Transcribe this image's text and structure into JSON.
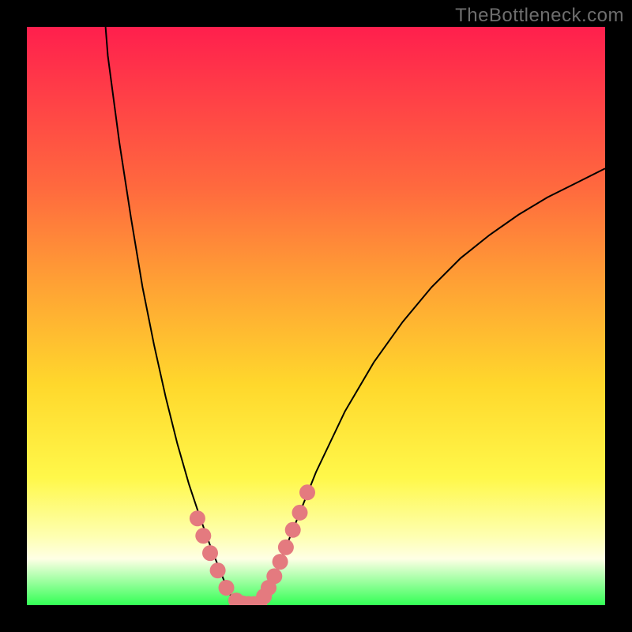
{
  "watermark": "TheBottleneck.com",
  "colors": {
    "frame": "#000000",
    "watermark_text": "#6e6e6e",
    "curve_stroke": "#000000",
    "marker_fill": "#e47a7f",
    "gradient_stops": [
      "#ff1f4d",
      "#ff3a48",
      "#ff6a3e",
      "#ffa334",
      "#ffd82c",
      "#fff84a",
      "#feffb0",
      "#feffe5",
      "#33ff55"
    ]
  },
  "chart_data": {
    "type": "line",
    "title": "",
    "xlabel": "",
    "ylabel": "",
    "xlim": [
      0,
      100
    ],
    "ylim": [
      0,
      100
    ],
    "curve_left": {
      "x": [
        13.6,
        14.0,
        16.0,
        18.0,
        20.0,
        22.0,
        24.0,
        26.0,
        28.0,
        30.0,
        32.0,
        33.0,
        34.0,
        35.0,
        36.5
      ],
      "y": [
        100.0,
        95.0,
        80.0,
        67.0,
        55.0,
        45.0,
        36.0,
        28.0,
        21.0,
        15.0,
        9.5,
        7.0,
        4.5,
        2.0,
        0.3
      ]
    },
    "valley": {
      "x": [
        36.5,
        37.5,
        38.5,
        39.5,
        40.5
      ],
      "y": [
        0.3,
        0.0,
        0.0,
        0.0,
        0.3
      ]
    },
    "curve_right": {
      "x": [
        40.5,
        42.0,
        44.0,
        46.0,
        48.0,
        50.0,
        55.0,
        60.0,
        65.0,
        70.0,
        75.0,
        80.0,
        85.0,
        90.0,
        95.0,
        100.0
      ],
      "y": [
        0.3,
        3.0,
        8.0,
        13.0,
        18.0,
        23.0,
        33.5,
        42.0,
        49.0,
        55.0,
        60.0,
        64.0,
        67.5,
        70.5,
        73.0,
        75.5
      ]
    },
    "markers_left": {
      "x": [
        29.5,
        30.5,
        31.7,
        33.0,
        34.5,
        36.2
      ],
      "y": [
        15.0,
        12.0,
        9.0,
        6.0,
        3.0,
        0.8
      ]
    },
    "markers_valley": {
      "x": [
        37.3,
        38.3,
        39.3,
        40.2
      ],
      "y": [
        0.3,
        0.2,
        0.2,
        0.3
      ]
    },
    "markers_right": {
      "x": [
        41.0,
        41.8,
        42.8,
        43.8,
        44.8,
        46.0,
        47.2,
        48.5
      ],
      "y": [
        1.5,
        3.0,
        5.0,
        7.5,
        10.0,
        13.0,
        16.0,
        19.5
      ]
    },
    "marker_radius": 10
  }
}
